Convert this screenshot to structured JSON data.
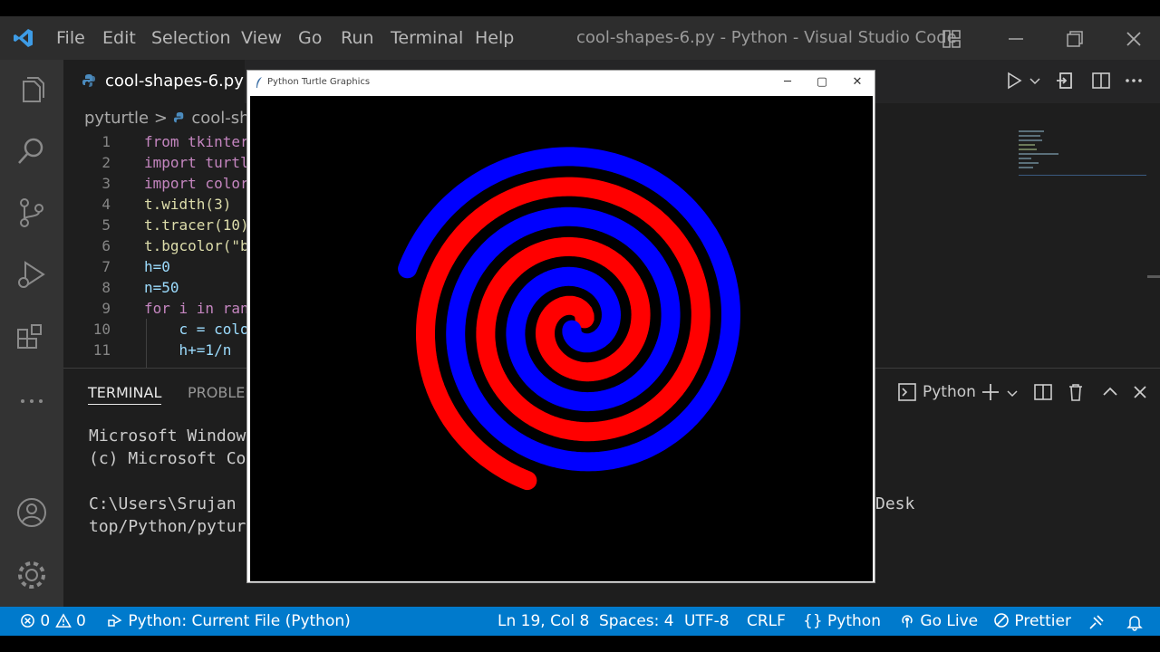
{
  "menu": [
    "File",
    "Edit",
    "Selection",
    "View",
    "Go",
    "Run",
    "Terminal",
    "Help"
  ],
  "window_title": "cool-shapes-6.py - Python - Visual Studio Code",
  "tab": {
    "label": "cool-shapes-6.py"
  },
  "breadcrumb": {
    "folder": "pyturtle",
    "file": "cool-sh"
  },
  "code_lines": [
    {
      "n": "1",
      "text": "from tkinter"
    },
    {
      "n": "2",
      "text": "import turtl"
    },
    {
      "n": "3",
      "text": "import color"
    },
    {
      "n": "4",
      "text": "t.width(3)"
    },
    {
      "n": "5",
      "text": "t.tracer(10)"
    },
    {
      "n": "6",
      "text": "t.bgcolor(\"b"
    },
    {
      "n": "7",
      "text": "h=0"
    },
    {
      "n": "8",
      "text": "n=50"
    },
    {
      "n": "9",
      "text": "for i in ran"
    },
    {
      "n": "10",
      "text": "    c = colo"
    },
    {
      "n": "11",
      "text": "    h+=1/n"
    }
  ],
  "panel": {
    "tab_terminal": "TERMINAL",
    "tab_problems": "PROBLEM",
    "shell_label": "Python",
    "lines": [
      "Microsoft Window",
      "(c) Microsoft Co",
      "",
      "C:\\Users\\Srujan",
      "top/Python/pytur"
    ],
    "right_fragment": "Desk"
  },
  "turtle_window": {
    "title": "Python Turtle Graphics"
  },
  "spiral": {
    "colors": [
      "#ff0000",
      "#0000ff"
    ],
    "background": "#000000"
  },
  "status": {
    "errors": "0",
    "warnings": "0",
    "interpreter": "Python: Current File (Python)",
    "position": "Ln 19, Col 8",
    "spaces": "Spaces: 4",
    "encoding": "UTF-8",
    "eol": "CRLF",
    "language": "Python",
    "golive": "Go Live",
    "prettier": "Prettier"
  }
}
